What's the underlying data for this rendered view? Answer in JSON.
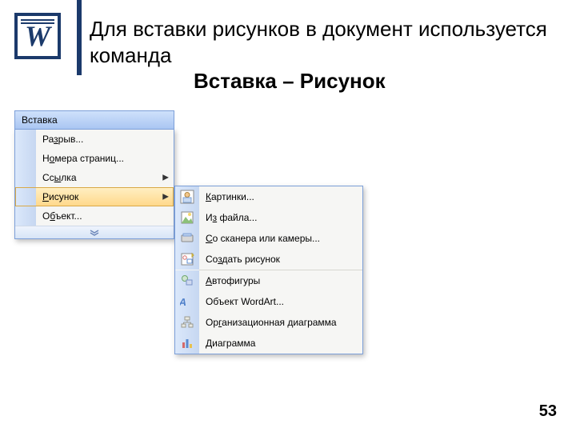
{
  "headline": {
    "line1": "Для вставки рисунков в документ используется команда",
    "line2": "Вставка – Рисунок"
  },
  "menu": {
    "title": "Вставка",
    "items": [
      {
        "label": "Разрыв...",
        "submenu": false
      },
      {
        "label": "Номера страниц...",
        "submenu": false
      },
      {
        "label": "Ссылка",
        "submenu": true
      },
      {
        "label": "Рисунок",
        "submenu": true,
        "highlight": true
      },
      {
        "label": "Объект...",
        "submenu": false
      }
    ]
  },
  "submenu": {
    "items": [
      {
        "label": "Картинки...",
        "icon": "clipart-icon"
      },
      {
        "label": "Из файла...",
        "icon": "from-file-icon"
      },
      {
        "label": "Со сканера или камеры...",
        "icon": "scanner-icon"
      },
      {
        "label": "Создать рисунок",
        "icon": "new-drawing-icon"
      },
      {
        "label": "Автофигуры",
        "icon": "autoshapes-icon"
      },
      {
        "label": "Объект WordArt...",
        "icon": "wordart-icon"
      },
      {
        "label": "Организационная диаграмма",
        "icon": "org-chart-icon"
      },
      {
        "label": "Диаграмма",
        "icon": "chart-icon"
      }
    ]
  },
  "page_number": "53"
}
